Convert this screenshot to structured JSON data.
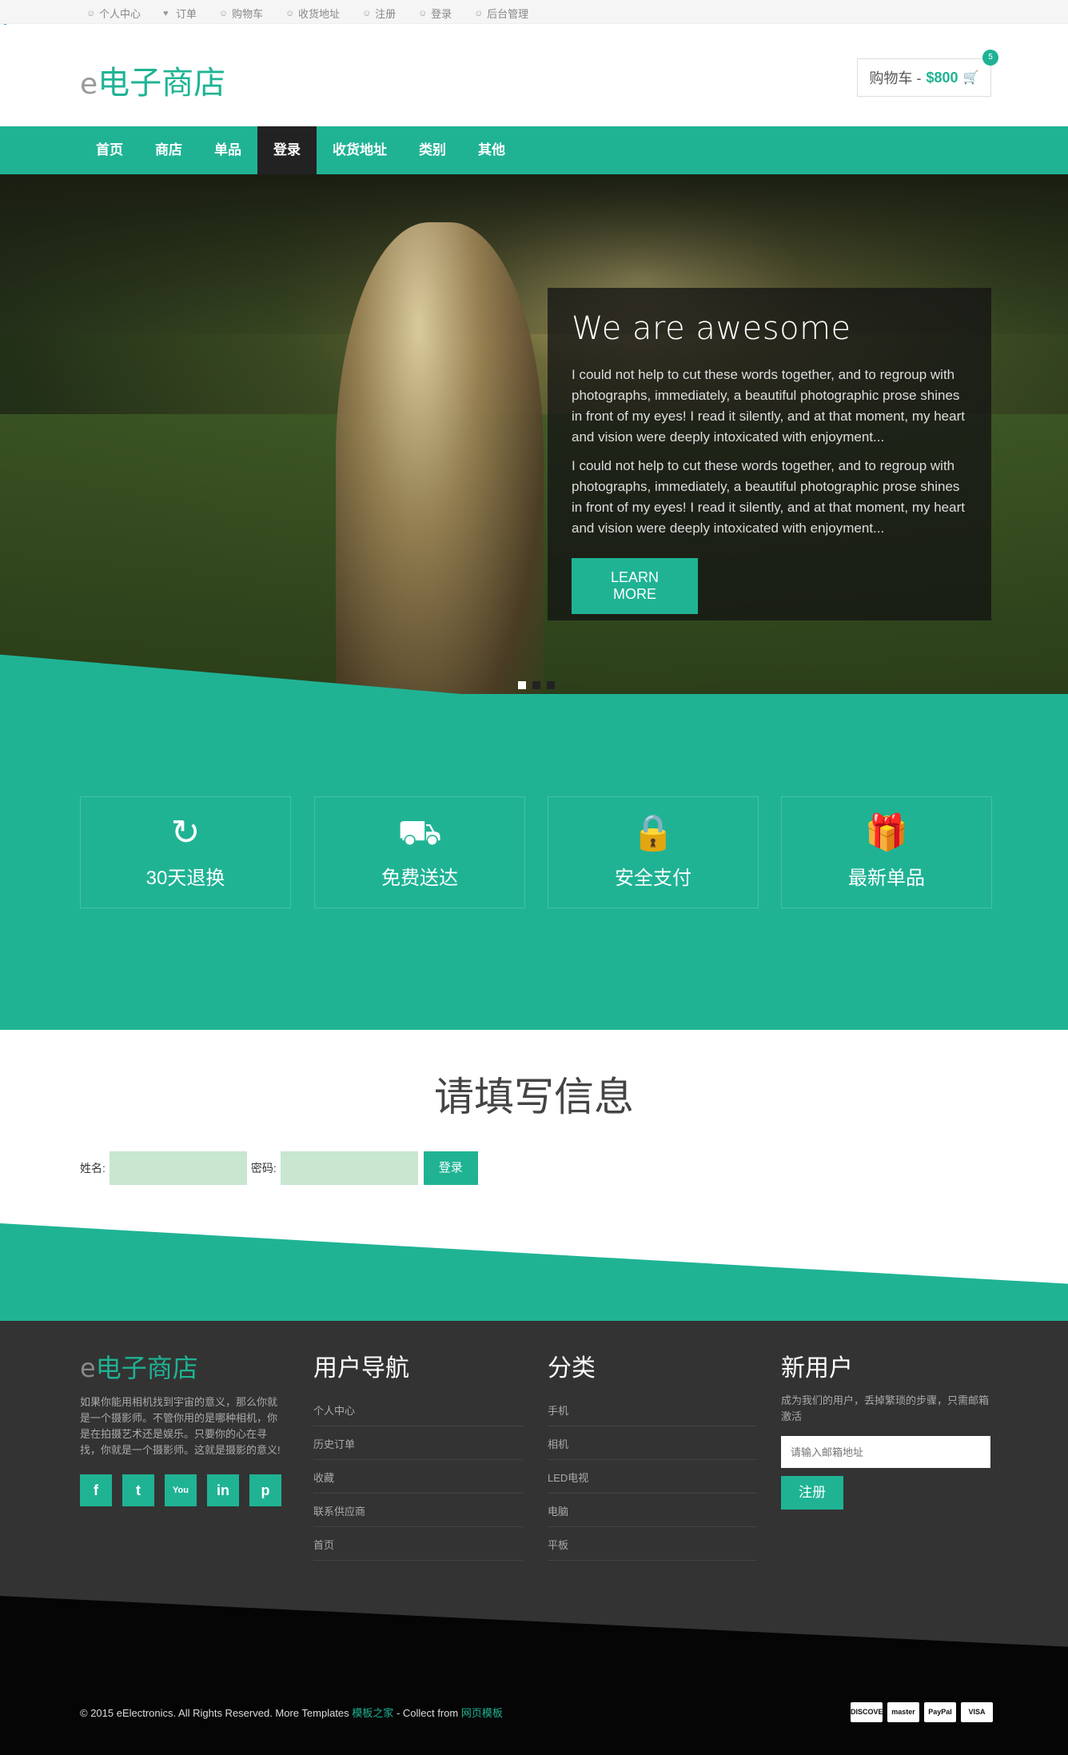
{
  "topbar": {
    "links": [
      {
        "label": "个人中心",
        "icon": "user-icon"
      },
      {
        "label": "订单",
        "icon": "heart-icon"
      },
      {
        "label": "购物车",
        "icon": "user-icon"
      },
      {
        "label": "收货地址",
        "icon": "user-icon"
      },
      {
        "label": "注册",
        "icon": "user-icon"
      },
      {
        "label": "登录",
        "icon": "user-icon"
      },
      {
        "label": "后台管理",
        "icon": "user-icon"
      }
    ]
  },
  "header": {
    "logo_e": "e",
    "logo_text": "电子商店",
    "cart_label": "购物车 -",
    "cart_price": "$800",
    "cart_count": "5"
  },
  "nav": {
    "items": [
      "首页",
      "商店",
      "单品",
      "登录",
      "收货地址",
      "类别",
      "其他"
    ],
    "active_index": 3
  },
  "hero": {
    "title": "We are awesome",
    "para1": "I could not help to cut these words together, and to regroup with photographs, immediately, a beautiful photographic prose shines in front of my eyes! I read it silently, and at that moment, my heart and vision were deeply intoxicated with enjoyment...",
    "para2": "I could not help to cut these words together, and to regroup with photographs, immediately, a beautiful photographic prose shines in front of my eyes! I read it silently, and at that moment, my heart and vision were deeply intoxicated with enjoyment...",
    "button": "LEARN MORE",
    "slide_count": 3,
    "active_slide": 1
  },
  "features": [
    {
      "label": "30天退换",
      "icon": "refresh-icon"
    },
    {
      "label": "免费送达",
      "icon": "truck-icon"
    },
    {
      "label": "安全支付",
      "icon": "lock-icon"
    },
    {
      "label": "最新单品",
      "icon": "gift-icon"
    }
  ],
  "form": {
    "title": "请填写信息",
    "name_label": "姓名:",
    "password_label": "密码:",
    "submit": "登录"
  },
  "footer": {
    "logo_e": "e",
    "logo_text": "电子商店",
    "description": "如果你能用相机找到宇宙的意义，那么你就是一个摄影师。不管你用的是哪种相机，你是在拍摄艺术还是娱乐。只要你的心在寻找，你就是一个摄影师。这就是摄影的意义!",
    "socials": [
      "f",
      "t",
      "You",
      "in",
      "p"
    ],
    "nav_title": "用户导航",
    "nav_links": [
      "个人中心",
      "历史订单",
      "收藏",
      "联系供应商",
      "首页"
    ],
    "cat_title": "分类",
    "cat_links": [
      "手机",
      "相机",
      "LED电视",
      "电脑",
      "平板"
    ],
    "new_title": "新用户",
    "new_desc": "成为我们的用户，丢掉繁琐的步骤，只需邮箱激活",
    "email_placeholder": "请输入邮箱地址",
    "register": "注册"
  },
  "bottom": {
    "copyright": "© 2015 eElectronics. All Rights Reserved. More Templates",
    "link1": "模板之家",
    "middle": "- Collect from",
    "link2": "网页模板",
    "payments": [
      "DISCOVER",
      "master",
      "PayPal",
      "VISA"
    ]
  },
  "colors": {
    "accent": "#1fb394",
    "dark": "#333333",
    "nav_active": "#222222",
    "input_bg": "#c8e6d0"
  }
}
